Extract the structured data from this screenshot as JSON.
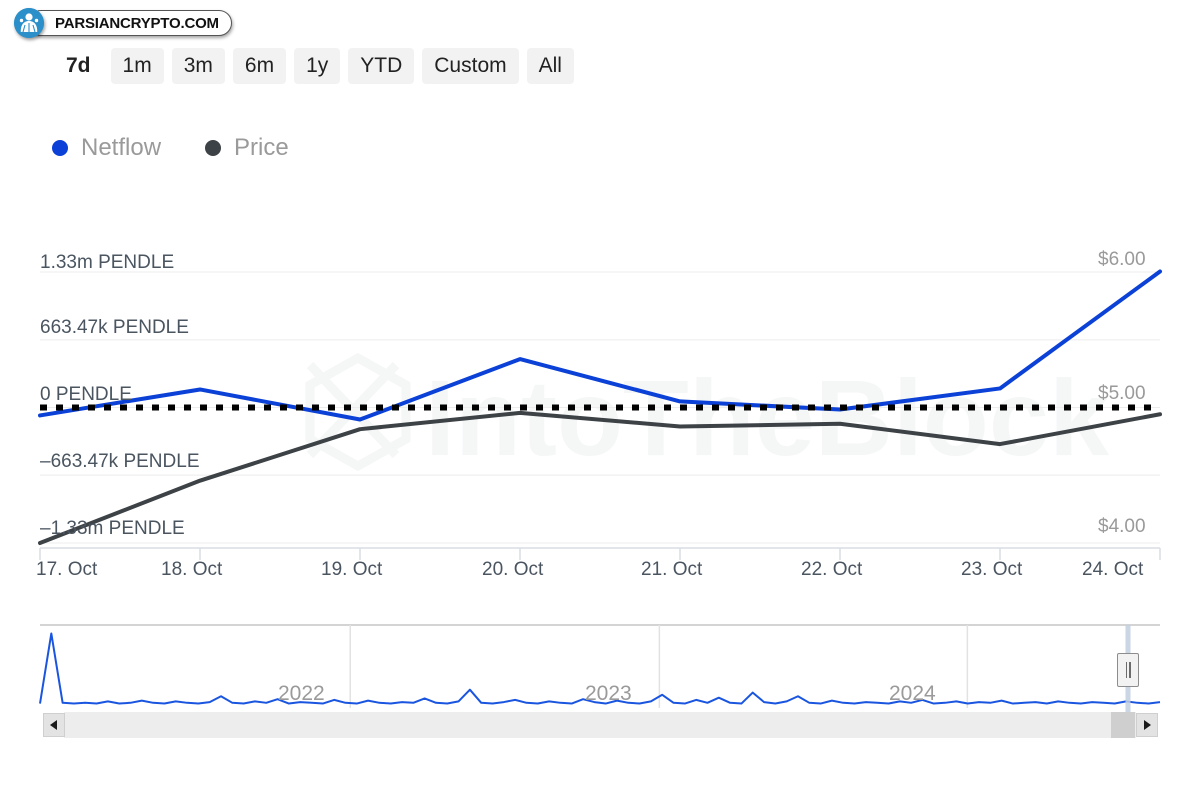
{
  "watermark": {
    "badge_text": "PARSIANCRYPTO.COM",
    "logo_icon": "parsiancrypto-logo-icon",
    "chart_watermark_text": "IntoTheBlock"
  },
  "range_selector": {
    "selected": "7d",
    "options": [
      "7d",
      "1m",
      "3m",
      "6m",
      "1y",
      "YTD",
      "Custom",
      "All"
    ]
  },
  "legend": {
    "items": [
      {
        "label": "Netflow",
        "color": "#0b41d6",
        "icon": "legend-dot-icon"
      },
      {
        "label": "Price",
        "color": "#3d4246",
        "icon": "legend-dot-icon"
      }
    ]
  },
  "navigator": {
    "years": [
      "2022",
      "2023",
      "2024"
    ],
    "left_arrow_icon": "chevron-left-icon",
    "right_arrow_icon": "chevron-right-icon",
    "handle_icon": "grip-handle-icon"
  },
  "chart_data": {
    "type": "line",
    "title": "",
    "subtitle": "",
    "xlabel": "",
    "ylabel": "Netflow",
    "y2label": "Price",
    "grid": true,
    "legend_position": "top-left",
    "x": [
      "17. Oct",
      "18. Oct",
      "19. Oct",
      "20. Oct",
      "21. Oct",
      "22. Oct",
      "23. Oct",
      "24. Oct"
    ],
    "xtick_labels": [
      "17. Oct",
      "18. Oct",
      "19. Oct",
      "20. Oct",
      "21. Oct",
      "22. Oct",
      "23. Oct",
      "24. Oct"
    ],
    "ytick_labels": [
      "1.33m PENDLE",
      "663.47k PENDLE",
      "0 PENDLE",
      "–663.47k PENDLE",
      "–1.33m PENDLE"
    ],
    "ytick_values": [
      1330000,
      663470,
      0,
      -663470,
      -1330000
    ],
    "ylim": [
      -1330000,
      1330000
    ],
    "y2tick_labels": [
      "$6.00",
      "$5.00",
      "$4.00"
    ],
    "y2tick_values": [
      6.0,
      5.0,
      4.0
    ],
    "y2lim": [
      3.5,
      6.5
    ],
    "zero_line": {
      "value": 0,
      "style": "dotted",
      "color": "#000000"
    },
    "series": [
      {
        "name": "Netflow",
        "color": "#0b41d6",
        "axis": "left",
        "unit": "PENDLE",
        "values": [
          -78000,
          177000,
          -118000,
          475000,
          60000,
          -20000,
          187000,
          1335000
        ]
      },
      {
        "name": "Price",
        "color": "#3d4246",
        "axis": "right",
        "unit": "USD",
        "values": [
          4.0,
          4.46,
          4.84,
          4.96,
          4.86,
          4.88,
          4.73,
          4.95
        ]
      }
    ],
    "navigator_series": {
      "name": "Netflow",
      "color": "#1a55e0",
      "values": [
        0.02,
        0.98,
        0.03,
        0.02,
        0.03,
        0.02,
        0.05,
        0.02,
        0.03,
        0.06,
        0.03,
        0.02,
        0.05,
        0.03,
        0.02,
        0.04,
        0.12,
        0.03,
        0.02,
        0.05,
        0.03,
        0.08,
        0.02,
        0.04,
        0.03,
        0.02,
        0.07,
        0.03,
        0.02,
        0.06,
        0.03,
        0.02,
        0.04,
        0.03,
        0.09,
        0.03,
        0.02,
        0.05,
        0.21,
        0.03,
        0.02,
        0.04,
        0.07,
        0.03,
        0.02,
        0.05,
        0.03,
        0.02,
        0.08,
        0.04,
        0.02,
        0.06,
        0.03,
        0.02,
        0.05,
        0.14,
        0.03,
        0.02,
        0.07,
        0.03,
        0.1,
        0.03,
        0.02,
        0.17,
        0.04,
        0.02,
        0.05,
        0.12,
        0.03,
        0.02,
        0.06,
        0.03,
        0.02,
        0.04,
        0.03,
        0.02,
        0.05,
        0.03,
        0.07,
        0.02,
        0.03,
        0.05,
        0.02,
        0.04,
        0.03,
        0.06,
        0.02,
        0.03,
        0.04,
        0.02,
        0.05,
        0.03,
        0.02,
        0.04,
        0.03,
        0.02,
        0.05,
        0.03,
        0.02,
        0.04
      ]
    }
  }
}
